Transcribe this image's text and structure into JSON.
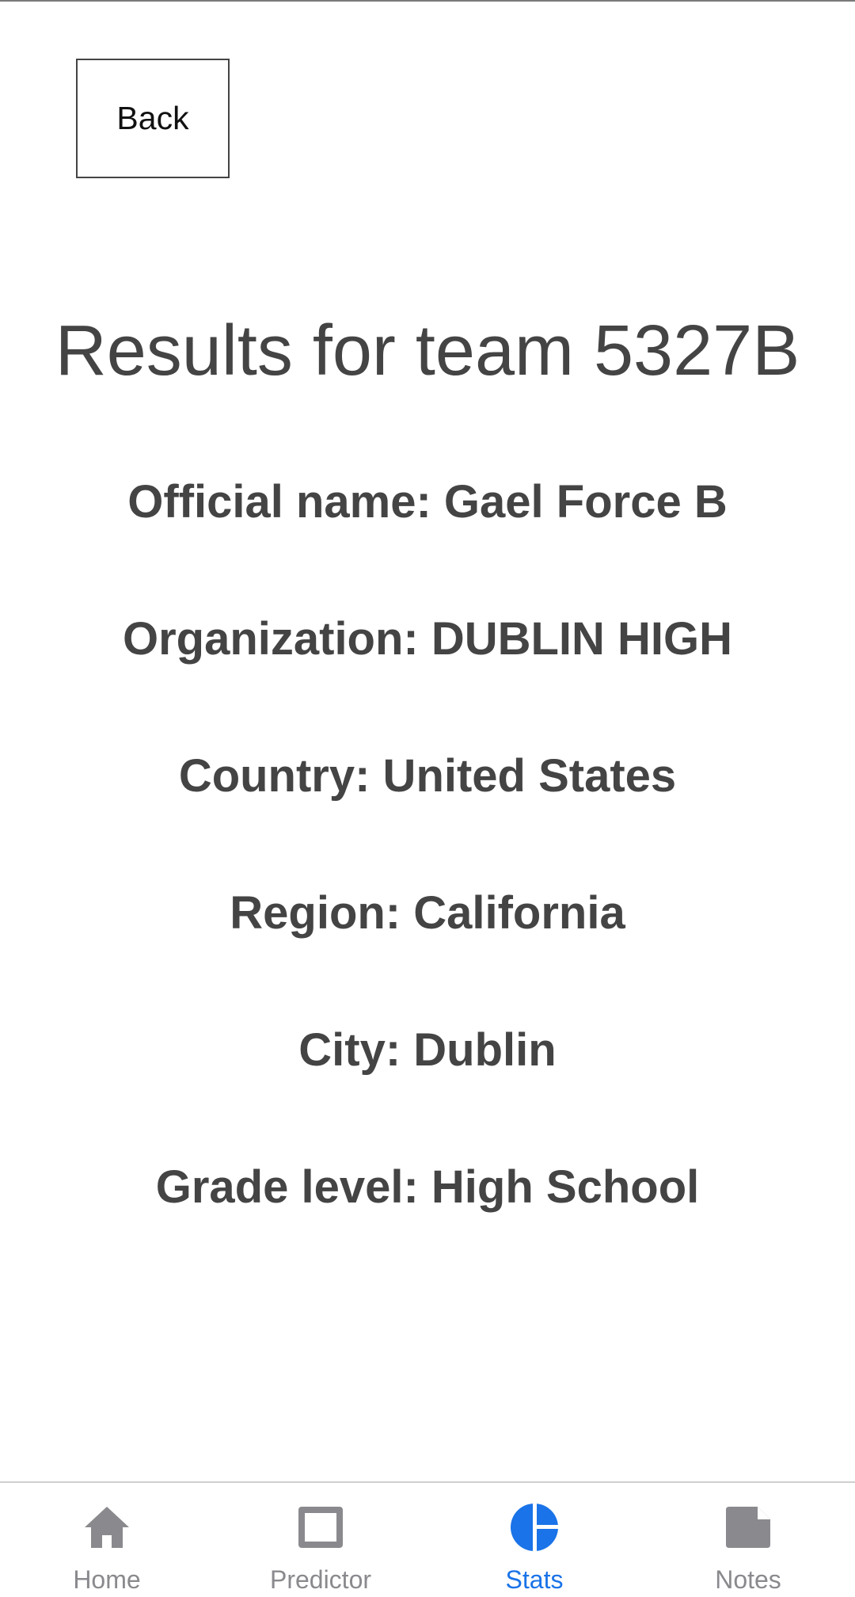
{
  "header": {
    "back_label": "Back"
  },
  "main": {
    "title": "Results for team 5327B",
    "info": [
      "Official name: Gael Force B",
      "Organization: DUBLIN HIGH",
      "Country: United States",
      "Region: California",
      "City: Dublin",
      "Grade level: High School"
    ]
  },
  "tabs": [
    {
      "label": "Home",
      "icon": "home-icon",
      "active": false
    },
    {
      "label": "Predictor",
      "icon": "square-icon",
      "active": false
    },
    {
      "label": "Stats",
      "icon": "pie-chart-icon",
      "active": true
    },
    {
      "label": "Notes",
      "icon": "note-icon",
      "active": false
    }
  ],
  "colors": {
    "active_tab": "#1a73e8",
    "inactive_tab": "#8a8a8e",
    "text": "#444444"
  }
}
